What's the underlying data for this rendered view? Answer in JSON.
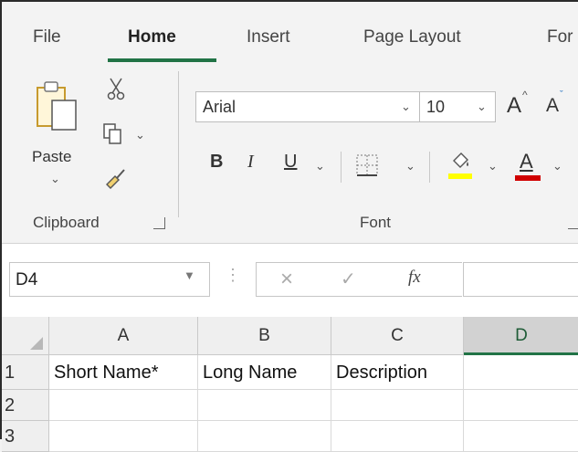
{
  "ribbon_tabs": [
    "File",
    "Home",
    "Insert",
    "Page Layout",
    "For"
  ],
  "clipboard": {
    "paste_label": "Paste",
    "group_label": "Clipboard"
  },
  "font": {
    "font_name": "Arial",
    "font_size": "10",
    "grow_label": "A",
    "shrink_label": "A",
    "bold": "B",
    "italic": "I",
    "underline": "U",
    "font_color_label": "A",
    "group_label": "Font",
    "highlight_color": "#ffff00",
    "font_color": "#d00000"
  },
  "formula_bar": {
    "name_box": "D4",
    "fx_label": "fx",
    "formula": ""
  },
  "sheet": {
    "columns": [
      "A",
      "B",
      "C",
      "D"
    ],
    "rows": [
      {
        "num": "1",
        "cells": [
          "Short Name*",
          "Long Name",
          "Description",
          ""
        ]
      },
      {
        "num": "2",
        "cells": [
          "",
          "",
          "",
          ""
        ]
      },
      {
        "num": "3",
        "cells": [
          "",
          "",
          "",
          ""
        ]
      }
    ],
    "selected_column": "D",
    "selected_cell": "D4"
  },
  "accent_color": "#217346"
}
